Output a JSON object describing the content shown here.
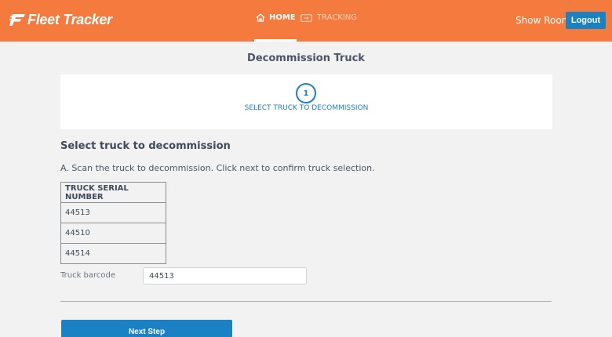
{
  "header": {
    "logo_text": "Fleet Tracker",
    "nav": [
      {
        "label": "HOME",
        "icon": "home-icon",
        "active": true
      },
      {
        "label": "TRACKING",
        "icon": "truck-tracking-icon",
        "active": false
      }
    ],
    "show_room": "Show Room",
    "logout_label": "Logout"
  },
  "colors": {
    "header_bg": "#f47b3d",
    "accent": "#1a82c4",
    "page_bg": "#f2f2f2"
  },
  "page": {
    "title": "Decommission Truck"
  },
  "stepper": {
    "step_number": "1",
    "step_label": "SELECT TRUCK TO DECOMMISSION"
  },
  "section": {
    "title": "Select truck to decommission",
    "instruction": "A. Scan the truck to decommission. Click next to confirm truck selection."
  },
  "table": {
    "header": "TRUCK SERIAL NUMBER",
    "rows": [
      "44513",
      "44510",
      "44514"
    ]
  },
  "barcode": {
    "label": "Truck barcode",
    "value": "44513"
  },
  "next_label": "Next Step"
}
